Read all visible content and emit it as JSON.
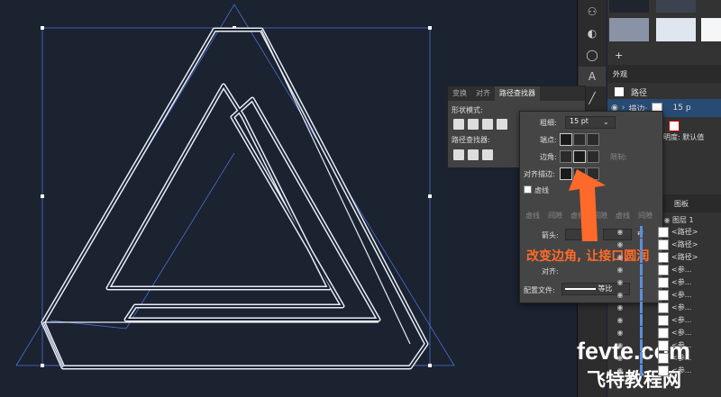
{
  "tools": [
    "shape-builder-icon",
    "blend-icon",
    "rotate-icon",
    "type-icon",
    "line-icon"
  ],
  "swatches": {
    "colors": [
      "#20242e",
      "#3c4250",
      "#8a93a6",
      "#dfe6f0",
      "#f4f6f8"
    ]
  },
  "appearance": {
    "tab": "外观",
    "object_label": "路径",
    "stroke_label": "描边:",
    "stroke_weight": "15 p",
    "opacity_label": "不透明度: 默认值",
    "opacity_short": "明度: 默认值"
  },
  "layers": {
    "tab": "图板",
    "layer_name": "图层 1",
    "items": [
      "<路径>",
      "<路径>",
      "<路径>",
      "<参...",
      "<参...",
      "<参...",
      "<参...",
      "<参...",
      "<参...",
      "<参...",
      "<参...",
      "<参..."
    ]
  },
  "pathfinder": {
    "tabs": [
      "变换",
      "对齐",
      "路径查找器"
    ],
    "shape_modes_label": "形状模式:",
    "pathfinders_label": "路径查找器:"
  },
  "stroke": {
    "weight_label": "粗细:",
    "weight_value": "15 pt",
    "cap_label": "端点:",
    "corner_label": "边角:",
    "limit_label": "限制:",
    "align_label": "对齐描边:",
    "dashed_label": "虚线",
    "dash_labels": [
      "虚线",
      "间隙",
      "虚线",
      "间隙",
      "虚线",
      "间隙"
    ],
    "arrow_label": "箭头:",
    "align_short": "对齐:",
    "profile_label": "配置文件:",
    "profile_value": "等比"
  },
  "annotation": "改变边角, 让接口圆润",
  "watermark": {
    "line1": "fevte.com",
    "line2": "飞特教程网"
  }
}
